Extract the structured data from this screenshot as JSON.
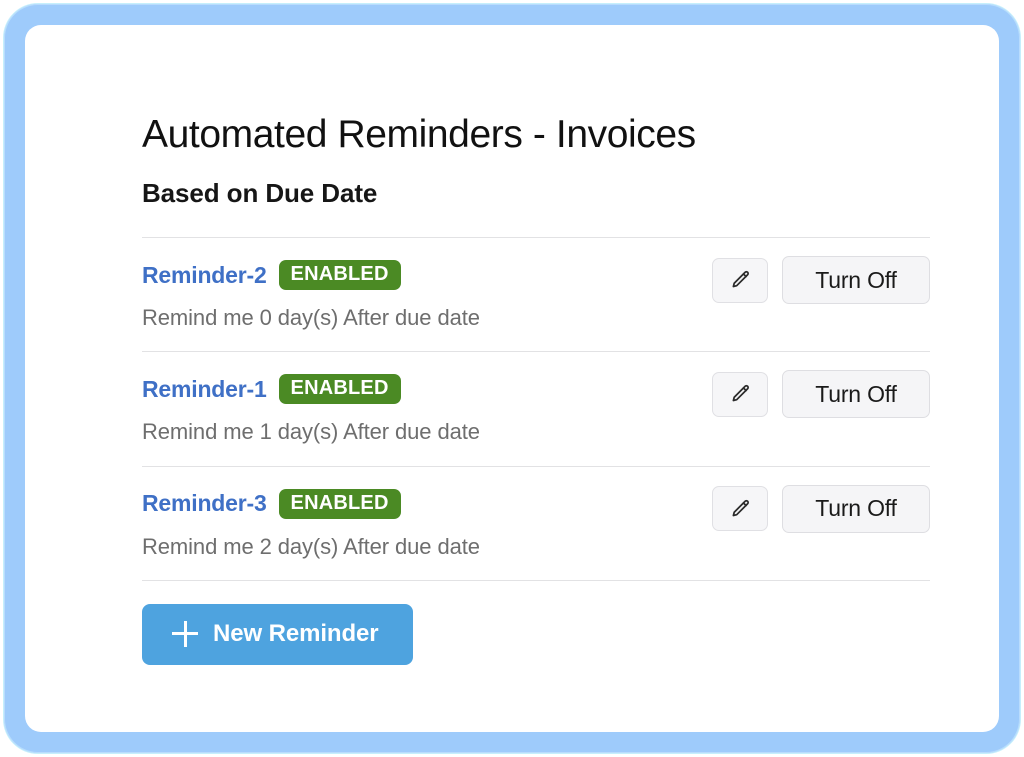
{
  "page": {
    "title": "Automated Reminders - Invoices",
    "subtitle": "Based on Due Date"
  },
  "reminders": [
    {
      "name": "Reminder-2",
      "status": "ENABLED",
      "description": "Remind me 0 day(s) After due date",
      "edit_icon": "pencil-icon",
      "toggle_label": "Turn Off"
    },
    {
      "name": "Reminder-1",
      "status": "ENABLED",
      "description": "Remind me 1 day(s) After due date",
      "edit_icon": "pencil-icon",
      "toggle_label": "Turn Off"
    },
    {
      "name": "Reminder-3",
      "status": "ENABLED",
      "description": "Remind me 2 day(s) After due date",
      "edit_icon": "pencil-icon",
      "toggle_label": "Turn Off"
    }
  ],
  "footer": {
    "new_reminder_label": "New Reminder",
    "new_reminder_icon": "plus-icon"
  },
  "colors": {
    "link": "#3f70c6",
    "badge_green": "#4b8a24",
    "primary_blue": "#4ea3df",
    "frame_blue": "#9ecbfb",
    "muted_text": "#6e6e6e",
    "button_bg": "#f5f5f7"
  }
}
